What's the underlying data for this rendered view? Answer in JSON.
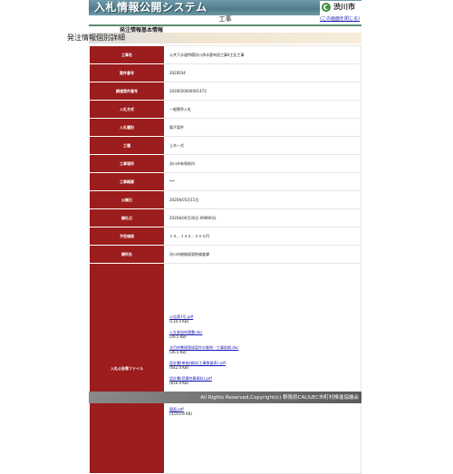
{
  "header": {
    "system_title": "入札情報公開システム",
    "city_name": "渋川市",
    "section_label": "工事",
    "close_link": "この画面を閉じる"
  },
  "section": {
    "basic_info_label": "発注情報基本情報",
    "detail_title": "発注情報個別詳細"
  },
  "rows": [
    {
      "key": "工事名",
      "value": "公共下水道特環渋川浄水管布設工事4工区工事"
    },
    {
      "key": "案件番号",
      "value": "2020034"
    },
    {
      "key": "調達案件番号",
      "value": "2020020000001473"
    },
    {
      "key": "入札方式",
      "value": "一般競争入札"
    },
    {
      "key": "入札種別",
      "value": "電子案件"
    },
    {
      "key": "工種",
      "value": "土木一式"
    },
    {
      "key": "工事場所",
      "value": "渋川市有馬地内"
    },
    {
      "key": "工事概要",
      "value": "***"
    },
    {
      "key": "公開日",
      "value": "2020年05月15日"
    },
    {
      "key": "開札日",
      "value": "2020年06月30日 09時00分"
    },
    {
      "key": "予定価格",
      "value": "１５，３４０，０００円"
    },
    {
      "key": "課所名",
      "value": "渋川市総務部契約検査課"
    }
  ],
  "files": {
    "key": "入札公告等ファイル",
    "items": [
      {
        "name": "公告第1号.pdf",
        "size": "(110.4 KB)"
      },
      {
        "name": "入札参加申請書.doc",
        "size": "(26.5 KB)"
      },
      {
        "name": "全目的整理登録案件の質問・工事前期.doc",
        "size": "(36.5 KB)"
      },
      {
        "name": "設計書(単価)資料(工事数量表).pdf",
        "size": "(642.4 KB)"
      },
      {
        "name": "設計書(見積合算資料).pdf",
        "size": "(816.9 KB)"
      },
      {
        "name": "情報処理書.pdf",
        "size": "(389.3 KB)"
      },
      {
        "name": "図面.pdf",
        "size": "(3,015.8 KB)"
      }
    ]
  },
  "footer": {
    "copyright": "All Rights Reserved,Copyright(c) 群馬県CALS/EC市町村推進協議会"
  },
  "colors": {
    "header_teal": "#5b8795",
    "key_cell_red": "#9c1d1d",
    "link_blue": "#1a1ab5",
    "footer_gray": "#6a6a6a"
  }
}
